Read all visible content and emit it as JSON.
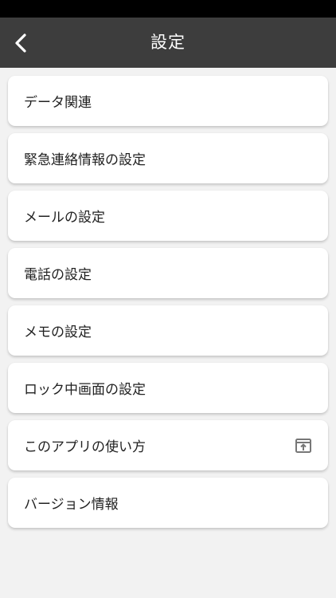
{
  "header": {
    "title": "設定",
    "back_icon": "chevron-left-icon"
  },
  "colors": {
    "header_bg": "#3d3d3d",
    "page_bg": "#f2f2f2",
    "card_bg": "#ffffff",
    "icon_gray": "#777777"
  },
  "menu": {
    "items": [
      {
        "label": "データ関連"
      },
      {
        "label": "緊急連絡情報の設定"
      },
      {
        "label": "メールの設定"
      },
      {
        "label": "電話の設定"
      },
      {
        "label": "メモの設定"
      },
      {
        "label": "ロック中画面の設定"
      },
      {
        "label": "このアプリの使い方",
        "icon": "open-external-icon"
      },
      {
        "label": "バージョン情報"
      }
    ]
  }
}
